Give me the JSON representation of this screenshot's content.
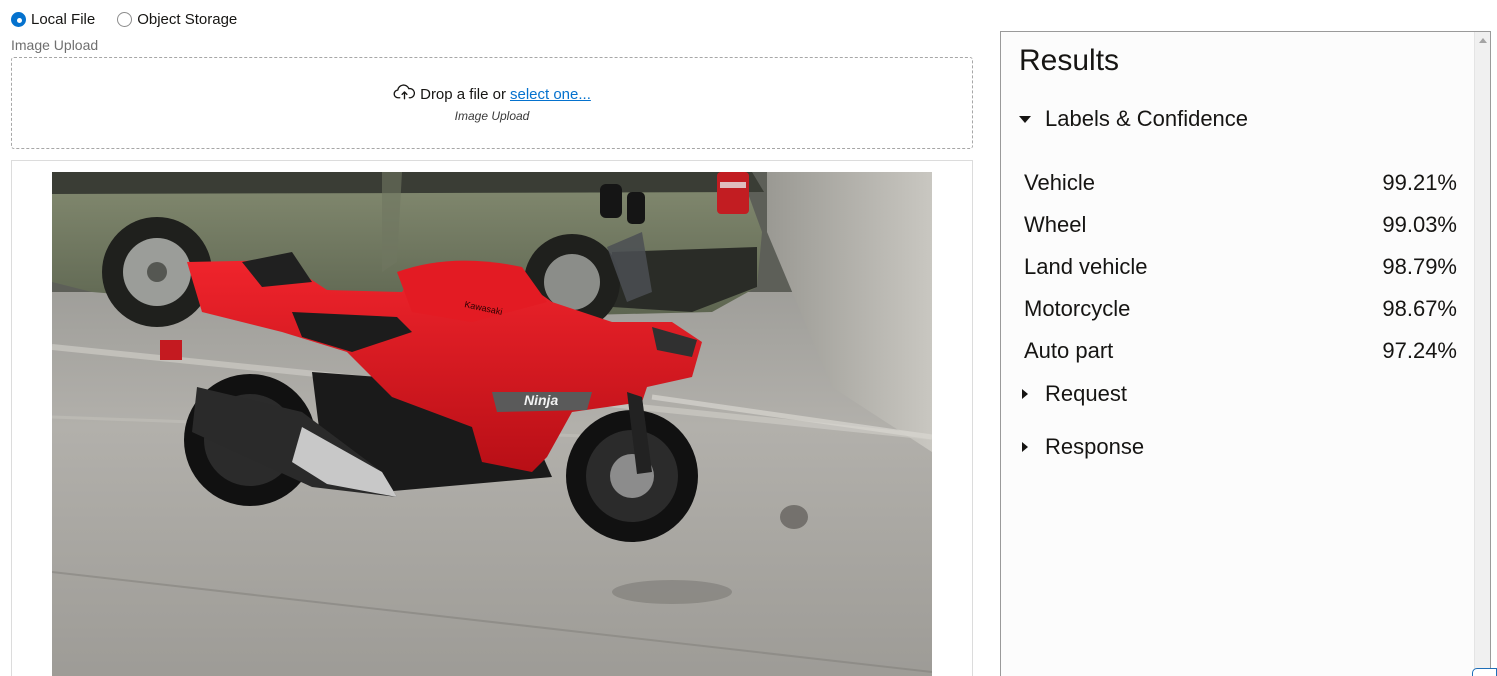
{
  "source": {
    "options": [
      {
        "label": "Local File",
        "selected": true
      },
      {
        "label": "Object Storage",
        "selected": false
      }
    ]
  },
  "upload": {
    "field_label": "Image Upload",
    "drop_text": "Drop a file or",
    "select_link": "select one...",
    "sub_label": "Image Upload",
    "icon": "cloud-upload-icon"
  },
  "preview": {
    "image": "photo of a red Kawasaki Ninja motorcycle parked in a garage next to a green car",
    "tank_brand": "Kawasaki",
    "fairing_logo": "Ninja"
  },
  "results": {
    "title": "Results",
    "labels_section": "Labels & Confidence",
    "labels": [
      {
        "name": "Vehicle",
        "confidence": "99.21%"
      },
      {
        "name": "Wheel",
        "confidence": "99.03%"
      },
      {
        "name": "Land vehicle",
        "confidence": "98.79%"
      },
      {
        "name": "Motorcycle",
        "confidence": "98.67%"
      },
      {
        "name": "Auto part",
        "confidence": "97.24%"
      }
    ],
    "request_section": "Request",
    "response_section": "Response"
  },
  "colors": {
    "accent": "#0572ce",
    "text": "#161513",
    "bike_red": "#d8161d"
  }
}
